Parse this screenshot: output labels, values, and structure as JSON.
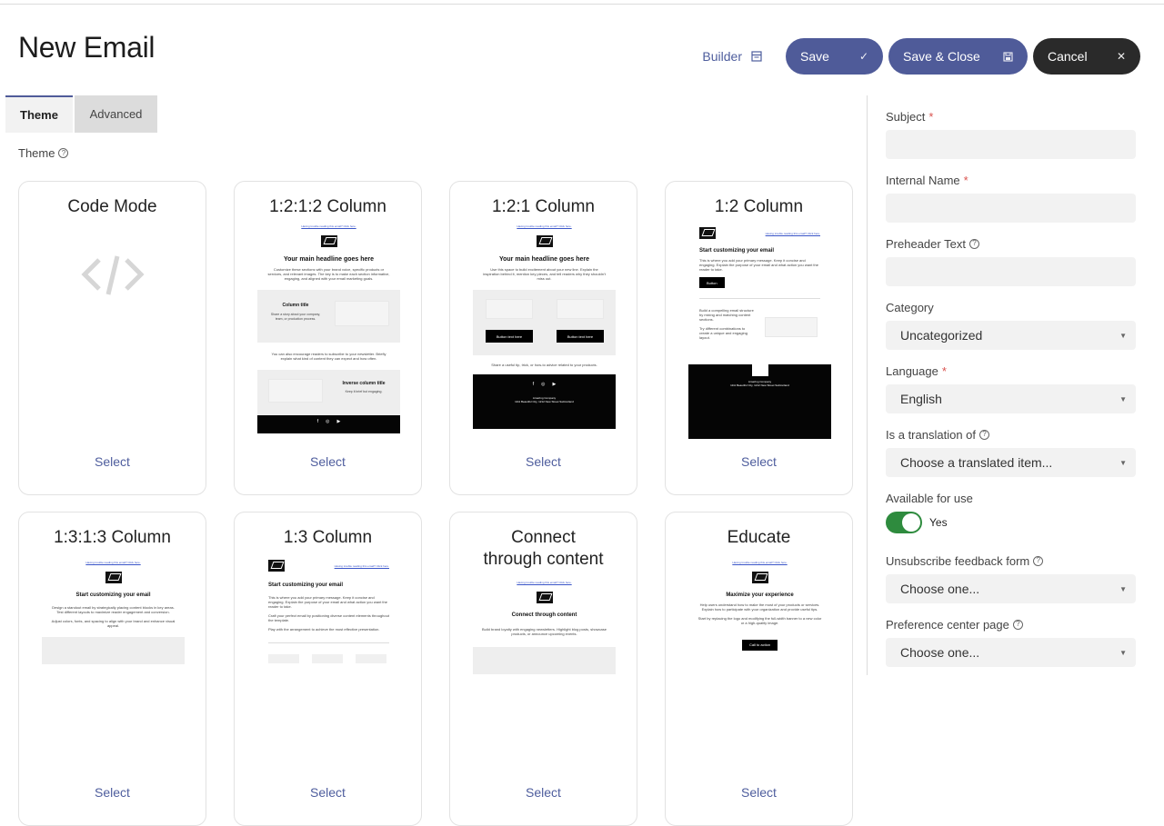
{
  "header": {
    "title": "New Email",
    "builder_label": "Builder",
    "save_label": "Save",
    "save_close_label": "Save & Close",
    "cancel_label": "Cancel"
  },
  "tabs": [
    {
      "label": "Theme",
      "active": true
    },
    {
      "label": "Advanced",
      "active": false
    }
  ],
  "theme_label": "Theme",
  "themes": [
    {
      "title": "Code Mode",
      "select": "Select"
    },
    {
      "title": "1:2:1:2 Column",
      "select": "Select",
      "preview": {
        "link": "Having trouble reading this email? Click here.",
        "headline": "Your main headline goes here",
        "body": "Customize these sections with your brand voice, specific products or services, and relevant images. The key is to make each section informative, engaging, and aligned with your email marketing goals.",
        "column_title": "Column title",
        "column_text": "Share a story about your company, team, or production process.",
        "mid_text": "You can also encourage readers to subscribe to your newsletter. Briefly explain what kind of content they can expect and how often.",
        "inverse_title": "Inverse column title",
        "inverse_text": "Keep it brief but engaging."
      }
    },
    {
      "title": "1:2:1 Column",
      "select": "Select",
      "preview": {
        "link": "Having trouble reading this email? Click here.",
        "headline": "Your main headline goes here",
        "body": "Use this space to build excitement about your new line. Explain the inspiration behind it, mention key pieces, and tell readers why they shouldn't miss out.",
        "button": "Button text here",
        "tip": "Share a useful tip, trick, or how-to advice related to your products.",
        "company": "Amazing Company",
        "address": "1111 Beautiful City, 1212 New Street Switzerland"
      }
    },
    {
      "title": "1:2 Column",
      "select": "Select",
      "preview": {
        "link": "Having trouble reading this email? Click here.",
        "headline": "Start customizing your email",
        "body": "This is where you add your primary message. Keep it concise and engaging. Explain the purpose of your email and what action you want the reader to take.",
        "button": "Button",
        "build_text": "Build a compelling email structure by mixing and matching content sections.",
        "try_text": "Try different combinations to create a unique and engaging layout.",
        "company": "Amazing Company",
        "address": "1111 Beautiful City, 1212 New Street Switzerland"
      }
    },
    {
      "title": "1:3:1:3 Column",
      "select": "Select",
      "preview": {
        "link": "Having trouble reading this email? Click here.",
        "headline": "Start customizing your email",
        "body": "Design a standout email by strategically placing content blocks in key areas. Test different layouts to maximize reader engagement and conversion.",
        "body2": "Adjust colors, fonts, and spacing to align with your brand and enhance visual appeal."
      }
    },
    {
      "title": "1:3 Column",
      "select": "Select",
      "preview": {
        "link": "Having trouble reading this email? Click here.",
        "headline": "Start customizing your email",
        "body": "This is where you add your primary message. Keep it concise and engaging. Explain the purpose of your email and what action you want the reader to take.",
        "body2": "Craft your perfect email by positioning diverse content elements throughout the template.",
        "body3": "Play with the arrangement to achieve the most effective presentation."
      }
    },
    {
      "title": "Connect through content",
      "select": "Select",
      "preview": {
        "link": "Having trouble reading this email? Click here.",
        "headline": "Connect through content",
        "body": "Build brand loyalty with engaging newsletters. Highlight blog posts, showcase products, or announce upcoming events."
      }
    },
    {
      "title": "Educate",
      "select": "Select",
      "preview": {
        "link": "Having trouble reading this email? Click here.",
        "headline": "Maximize your experience",
        "body": "Help users understand how to make the most of your products or services. Explain how to participate with your organization and provide useful tips.",
        "body2": "Start by replacing the logo and modifying the full-width banner to a new color or a high-quality image.",
        "button": "Call to action"
      }
    }
  ],
  "sidebar": {
    "subject_label": "Subject",
    "internal_name_label": "Internal Name",
    "preheader_label": "Preheader Text",
    "category_label": "Category",
    "category_value": "Uncategorized",
    "language_label": "Language",
    "language_value": "English",
    "translation_label": "Is a translation of",
    "translation_value": "Choose a translated item...",
    "available_label": "Available for use",
    "available_value": "Yes",
    "unsubscribe_label": "Unsubscribe feedback form",
    "unsubscribe_value": "Choose one...",
    "preference_label": "Preference center page",
    "preference_value": "Choose one...",
    "required_mark": "*"
  },
  "colors": {
    "primary": "#4f5b99",
    "dark": "#2a2a2a",
    "toggle_on": "#2e8b3e",
    "link": "#4e5d9d"
  },
  "icons": {
    "builder": "builder-icon",
    "save": "check-icon",
    "save_close": "floppy-icon",
    "cancel": "close-icon",
    "help": "help-circle-icon",
    "code": "code-icon",
    "select_caret": "caret-down-icon"
  }
}
